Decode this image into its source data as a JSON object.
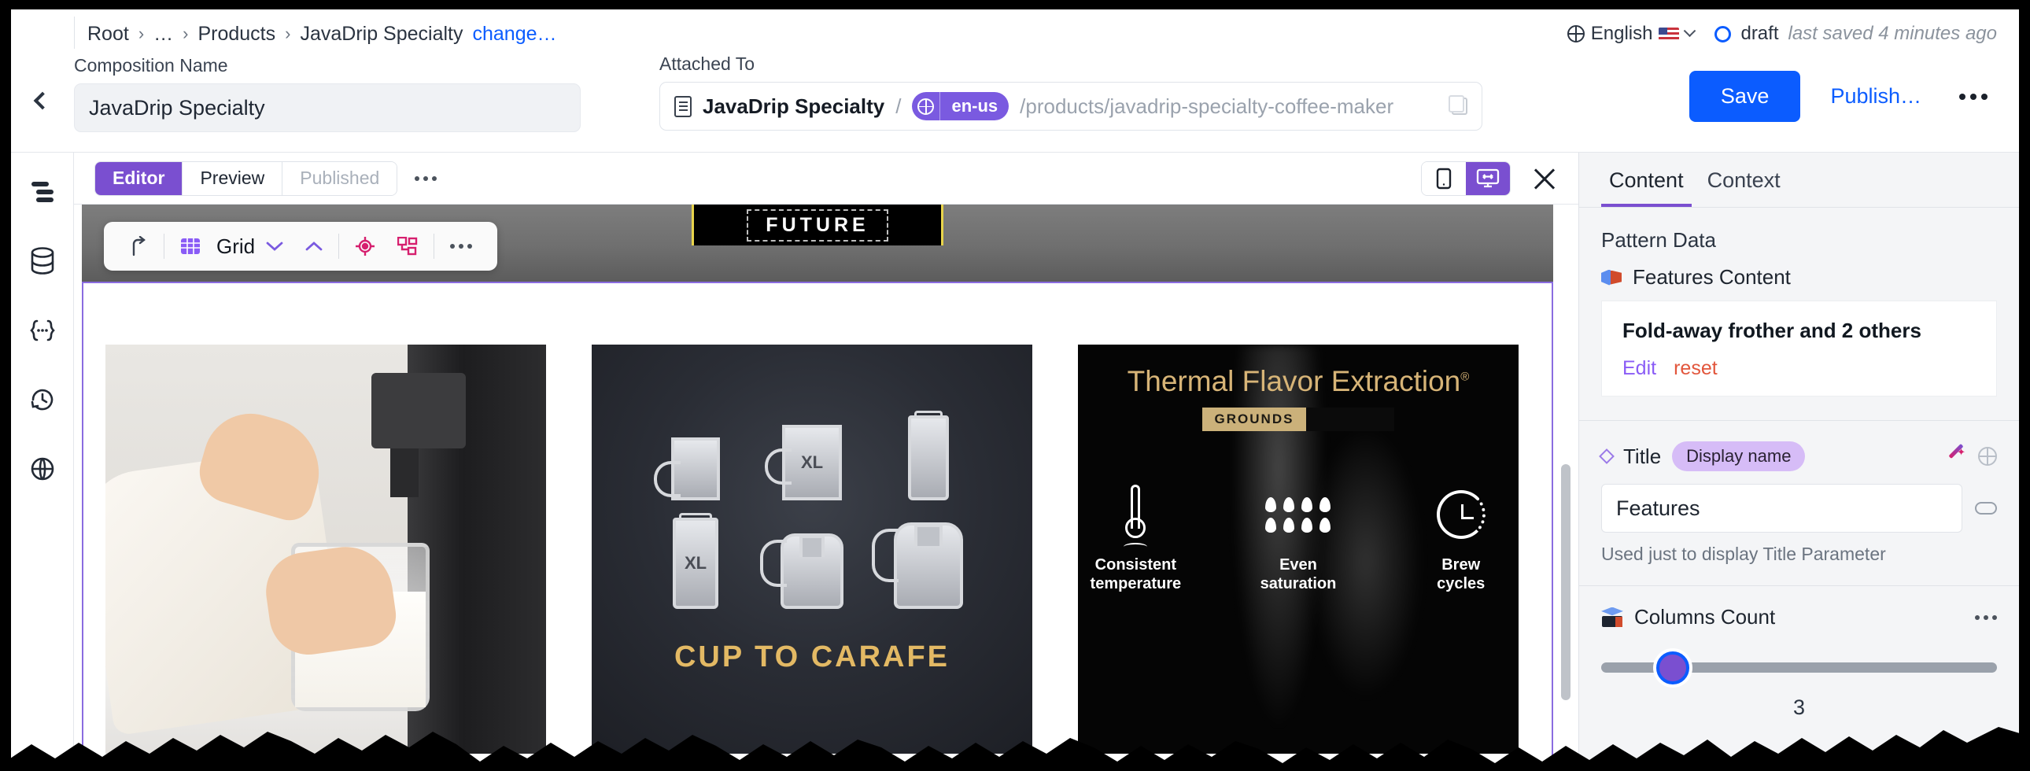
{
  "topbar": {
    "breadcrumb": [
      "Root",
      "…",
      "Products",
      "JavaDrip Specialty"
    ],
    "breadcrumb_separator": "›",
    "change_link": "change…",
    "language": "English",
    "language_icon": "globe-icon",
    "flag_icon": "us-flag-icon",
    "chevron_icon": "chevron-down-icon",
    "status": "draft",
    "status_icon": "draft-circle-icon",
    "saved_note": "last saved 4 minutes ago"
  },
  "meta": {
    "back_icon": "chevron-left-icon",
    "composition_label": "Composition Name",
    "composition_value": "JavaDrip Specialty",
    "composition_placeholder": "Composition Name",
    "attached_label": "Attached To",
    "attached_doc_icon": "document-icon",
    "attached_name": "JavaDrip Specialty",
    "attached_slash": "/",
    "attached_locale": "en-us",
    "attached_locale_icon": "globe-icon",
    "attached_path": "/products/javadrip-specialty-coffee-maker",
    "copy_icon": "copy-icon"
  },
  "actions": {
    "save_label": "Save",
    "publish_label": "Publish…",
    "more_icon": "more-horizontal-icon",
    "save_color": "#0b5cff"
  },
  "rail": {
    "items": [
      {
        "icon": "layers-icon",
        "name": "sidebar-item-layers"
      },
      {
        "icon": "database-icon",
        "name": "sidebar-item-database"
      },
      {
        "icon": "code-braces-icon",
        "name": "sidebar-item-code"
      },
      {
        "icon": "history-clock-icon",
        "name": "sidebar-item-history"
      },
      {
        "icon": "globe-icon",
        "name": "sidebar-item-globe"
      }
    ]
  },
  "editor": {
    "tabs": [
      {
        "label": "Editor",
        "state": "active"
      },
      {
        "label": "Preview",
        "state": "default"
      },
      {
        "label": "Published",
        "state": "disabled"
      }
    ],
    "tabs_more_icon": "more-horizontal-icon",
    "viewport": {
      "mobile_icon": "mobile-icon",
      "desktop_icon": "responsive-desktop-icon",
      "active": "desktop"
    },
    "close_icon": "close-icon",
    "accent": "#7a4fd0"
  },
  "grid_toolbar": {
    "up_icon": "move-up-icon",
    "grid_icon": "grid-icon",
    "label": "Grid",
    "down_chevron_icon": "chevron-down-icon",
    "up_chevron_icon": "chevron-up-icon",
    "target_icon": "target-icon",
    "components_icon": "components-icon",
    "more_icon": "more-horizontal-icon"
  },
  "canvas": {
    "banner_text": "FUTURE",
    "cards": [
      {
        "name": "milk-frother-photo",
        "type": "photo",
        "caption": ""
      },
      {
        "name": "cup-to-carafe-card",
        "type": "illustration",
        "title": "CUP TO CARAFE",
        "vessels": [
          "",
          "XL",
          "",
          "XL",
          "",
          ""
        ]
      },
      {
        "name": "thermal-flavor-extraction-card",
        "type": "illustration",
        "title": "Thermal Flavor Extraction",
        "title_sup": "®",
        "chip": "GROUNDS",
        "features": [
          {
            "icon": "thermometer-icon",
            "label": "Consistent\ntemperature",
            "line1": "Consistent",
            "line2": "temperature"
          },
          {
            "icon": "water-drops-icon",
            "label": "Even\nsaturation",
            "line1": "Even",
            "line2": "saturation"
          },
          {
            "icon": "clock-icon",
            "label": "Brew\ncycles",
            "line1": "Brew",
            "line2": "cycles"
          }
        ]
      }
    ]
  },
  "rightpanel": {
    "tabs": [
      {
        "label": "Content",
        "active": true
      },
      {
        "label": "Context",
        "active": false
      }
    ],
    "pattern_data_heading": "Pattern Data",
    "pattern_item_icon": "cube-icon",
    "pattern_item_label": "Features Content",
    "pattern_card_title": "Fold-away frother and 2 others",
    "pattern_edit_label": "Edit",
    "pattern_reset_label": "reset",
    "title_field": {
      "diamond_icon": "diamond-icon",
      "name": "Title",
      "badge": "Display name",
      "wand_icon": "magic-wand-icon",
      "globe_icon": "globe-icon",
      "value": "Features",
      "placeholder": "Title",
      "pill_icon": "toggle-pill-icon",
      "hint": "Used just to display Title Parameter"
    },
    "columns_count": {
      "icon": "book-cube-icon",
      "label": "Columns Count",
      "more_icon": "more-horizontal-icon",
      "value": "3",
      "thumb_position_pct": 18
    }
  },
  "colors": {
    "accent_purple": "#7a4fd0",
    "accent_blue": "#0b5cff",
    "locale_pill": "#7a5ae0",
    "reset_red": "#e2563c",
    "badge_lilac": "#d6bcf7",
    "gold": "#d7b477"
  }
}
